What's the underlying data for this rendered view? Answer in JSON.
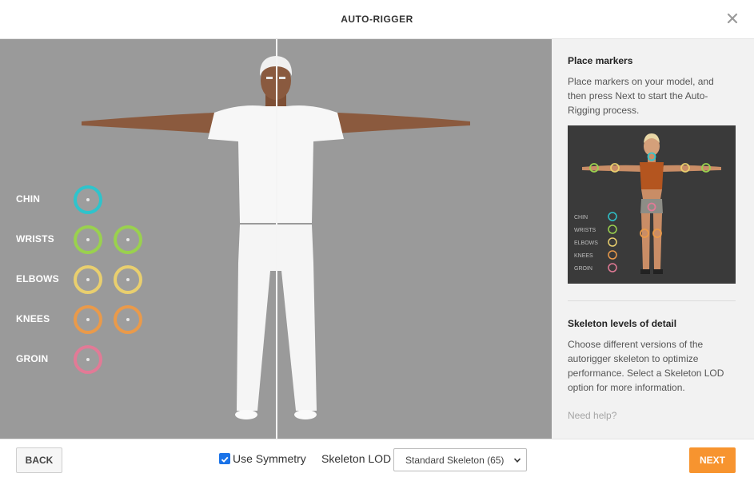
{
  "header": {
    "title": "AUTO-RIGGER",
    "close_icon": "close-icon"
  },
  "markers": [
    {
      "label": "CHIN",
      "color": "#2ec4cc",
      "count": 1
    },
    {
      "label": "WRISTS",
      "color": "#9ad14e",
      "count": 2
    },
    {
      "label": "ELBOWS",
      "color": "#e9cf6e",
      "count": 2
    },
    {
      "label": "KNEES",
      "color": "#ea9a4a",
      "count": 2
    },
    {
      "label": "GROIN",
      "color": "#e27a96",
      "count": 1
    }
  ],
  "side": {
    "place_title": "Place markers",
    "place_text": "Place markers on your model, and then press Next to start the Auto-Rigging process.",
    "preview_legend": [
      "CHIN",
      "WRISTS",
      "ELBOWS",
      "KNEES",
      "GROIN"
    ],
    "lod_title": "Skeleton levels of detail",
    "lod_text": "Choose different versions of the autorigger skeleton to optimize performance. Select a Skeleton LOD option for more information.",
    "help_link": "Need help?"
  },
  "footer": {
    "back_label": "BACK",
    "symmetry_label": "Use Symmetry",
    "symmetry_checked": true,
    "lod_label": "Skeleton LOD",
    "lod_selected": "Standard Skeleton (65)",
    "next_label": "NEXT"
  },
  "colors": {
    "accent": "#f7942f",
    "viewport_bg": "#9a9a9a",
    "sidebar_bg": "#f2f2f2"
  }
}
